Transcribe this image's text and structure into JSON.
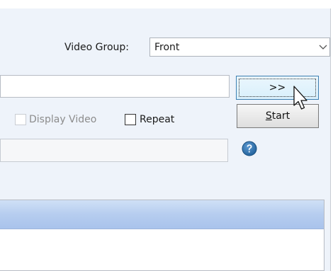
{
  "video_group": {
    "label": "Video Group:",
    "selected_value": "Front"
  },
  "buttons": {
    "browse_label": ">>",
    "start_label_prefix": "S",
    "start_label_rest": "tart"
  },
  "options": {
    "display_video_label": "Display Video",
    "display_video_checked": false,
    "display_video_enabled": false,
    "repeat_label": "Repeat",
    "repeat_checked": false
  },
  "colors": {
    "accent": "#3c7fb1",
    "help_icon": "#1f5f99",
    "list_header": "#b6cdef"
  },
  "icons": {
    "help": "help-icon",
    "dropdown": "chevron-down-icon",
    "pointer": "mouse-cursor-icon"
  }
}
